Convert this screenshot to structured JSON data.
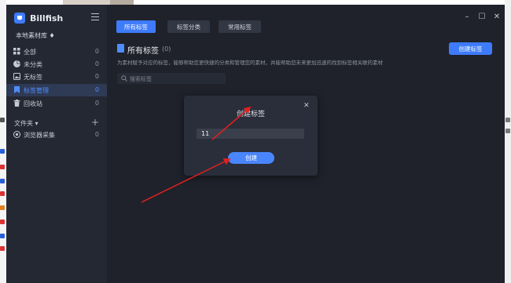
{
  "app": {
    "name": "Billfish",
    "library": "本地素材库 ♦"
  },
  "sidebar": {
    "items": [
      {
        "label": "全部",
        "count": "0",
        "icon": "grid-icon"
      },
      {
        "label": "未分类",
        "count": "0",
        "icon": "pie-icon"
      },
      {
        "label": "无标签",
        "count": "0",
        "icon": "image-icon"
      },
      {
        "label": "标签管理",
        "count": "0",
        "icon": "bookmark-icon",
        "active": true
      },
      {
        "label": "回收站",
        "count": "0",
        "icon": "trash-icon"
      }
    ],
    "folders_label": "文件夹 ▾",
    "folders_add": "+",
    "folder_items": [
      {
        "label": "浏览器采集",
        "count": "0",
        "icon": "globe-icon"
      }
    ]
  },
  "main": {
    "tabs": [
      {
        "label": "所有标签",
        "active": true
      },
      {
        "label": "标签分类",
        "active": false
      },
      {
        "label": "常用标签",
        "active": false
      }
    ],
    "section_title": "所有标签",
    "section_count": "(0)",
    "section_desc": "为素材赋予对应的标签，能够帮助您更快捷的分类和管理您的素材，并能帮助您未来更加迅速的找到标签相关联的素材",
    "create_tag_label": "创建标签",
    "search_placeholder": "搜索标签"
  },
  "window_controls": {
    "minimize": "–",
    "maximize": "☐",
    "close": "✕"
  },
  "dialog": {
    "title": "创建标签",
    "input_value": "11",
    "confirm_label": "创建",
    "close": "✕"
  },
  "colors": {
    "accent": "#3e7bfa",
    "sidebar_bg": "#242833",
    "main_bg": "#1f222b",
    "annotation_arrow": "#e02020"
  }
}
